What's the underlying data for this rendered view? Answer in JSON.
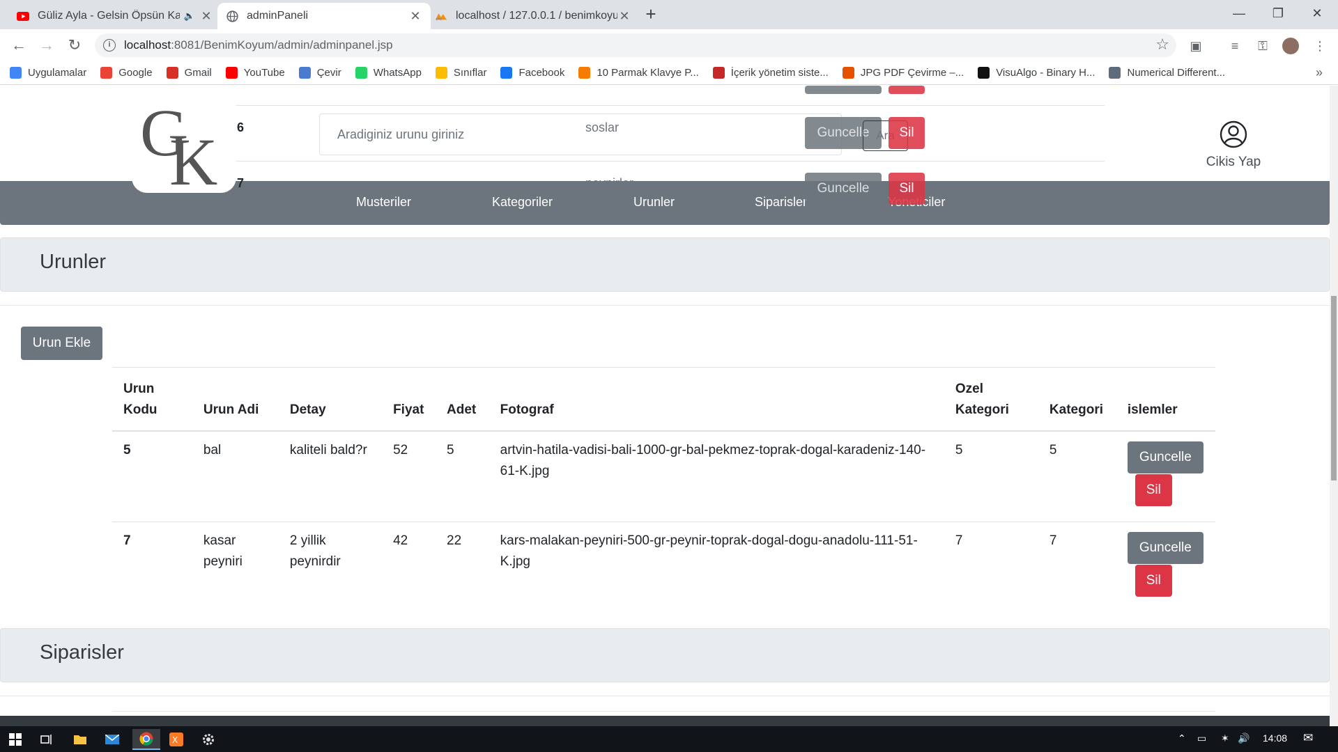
{
  "browser": {
    "tabs": [
      {
        "title": "Güliz Ayla - Gelsin Öpsün Kal",
        "active": false,
        "icon": "youtube-icon"
      },
      {
        "title": "adminPaneli",
        "active": true,
        "icon": "globe-icon"
      },
      {
        "title": "localhost / 127.0.0.1 / benimkoyu",
        "active": false,
        "icon": "phpmyadmin-icon"
      }
    ],
    "url_host": "localhost",
    "url_path": ":8081/BenimKoyum/admin/adminpanel.jsp",
    "bookmarks": [
      {
        "label": "Uygulamalar",
        "color": "#4285f4"
      },
      {
        "label": "Google",
        "color": "#ea4335"
      },
      {
        "label": "Gmail",
        "color": "#d93025"
      },
      {
        "label": "YouTube",
        "color": "#ff0000"
      },
      {
        "label": "Çevir",
        "color": "#4a7bd0"
      },
      {
        "label": "WhatsApp",
        "color": "#25d366"
      },
      {
        "label": "Sınıflar",
        "color": "#fbbc04"
      },
      {
        "label": "Facebook",
        "color": "#1877f2"
      },
      {
        "label": "10 Parmak Klavye P...",
        "color": "#f57c00"
      },
      {
        "label": "İçerik yönetim siste...",
        "color": "#c62828"
      },
      {
        "label": "JPG PDF Çevirme –...",
        "color": "#e65100"
      },
      {
        "label": "VisuAlgo - Binary H...",
        "color": "#111111"
      },
      {
        "label": "Numerical Different...",
        "color": "#5f6b7a"
      }
    ]
  },
  "header": {
    "logo_text": "GK",
    "search_placeholder": "Aradiginiz urunu giriniz",
    "search_button": "Ara",
    "logout_label": "Cikis Yap"
  },
  "nav": [
    "Musteriler",
    "Kategoriler",
    "Urunler",
    "Siparisler",
    "Yoneticiler"
  ],
  "overlay_rows": [
    {
      "num": "6",
      "name": "soslar",
      "update": "Guncelle",
      "delete": "Sil"
    },
    {
      "num": "7",
      "name": "peynirler",
      "update": "Guncelle",
      "delete": "Sil"
    }
  ],
  "products_section": {
    "title": "Urunler",
    "add_button": "Urun Ekle",
    "headers": {
      "code": "Urun Kodu",
      "name": "Urun Adi",
      "detail": "Detay",
      "price": "Fiyat",
      "qty": "Adet",
      "photo": "Fotograf",
      "special": "Ozel Kategori",
      "category": "Kategori",
      "actions": "islemler"
    },
    "rows": [
      {
        "code": "5",
        "name": "bal",
        "detail": "kaliteli bald?r",
        "price": "52",
        "qty": "5",
        "photo": "artvin-hatila-vadisi-bali-1000-gr-bal-pekmez-toprak-dogal-karadeniz-140-61-K.jpg",
        "special": "5",
        "category": "5",
        "update": "Guncelle",
        "delete": "Sil"
      },
      {
        "code": "7",
        "name": "kasar peyniri",
        "detail": "2 yillik peynirdir",
        "price": "42",
        "qty": "22",
        "photo": "kars-malakan-peyniri-500-gr-peynir-toprak-dogal-dogu-anadolu-111-51-K.jpg",
        "special": "7",
        "category": "7",
        "update": "Guncelle",
        "delete": "Sil"
      }
    ]
  },
  "orders_section": {
    "title": "Siparisler"
  },
  "taskbar": {
    "time": "14:08"
  }
}
